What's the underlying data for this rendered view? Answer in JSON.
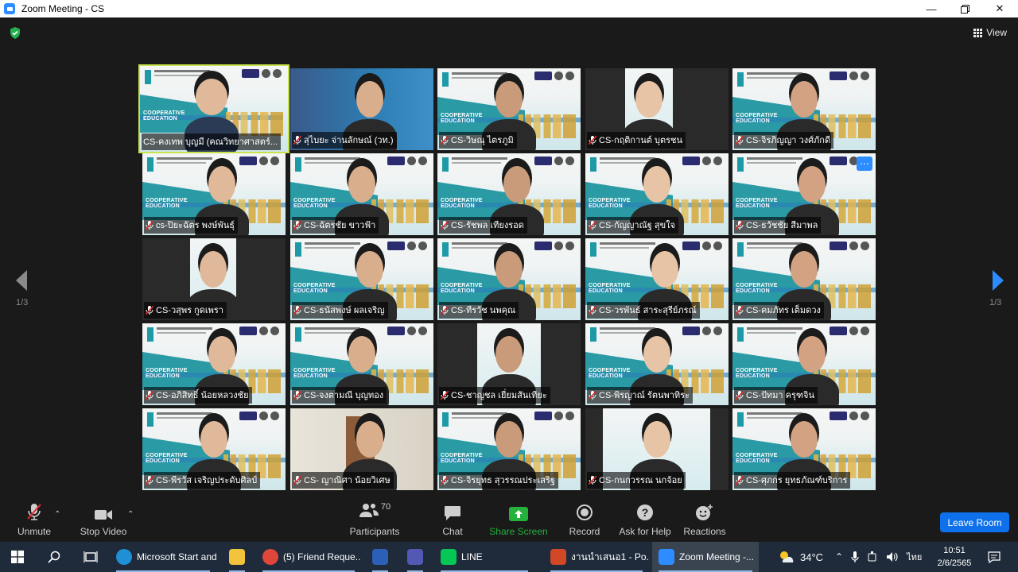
{
  "window": {
    "title": "Zoom Meeting - CS"
  },
  "meeting": {
    "view_label": "View",
    "page_left": "1/3",
    "page_right": "1/3"
  },
  "participants": [
    {
      "name": "CS-คงเทพ บุญมี (คณวิทยาศาสตร์...",
      "muted": false,
      "active": true
    },
    {
      "name": "สุไบยะ จ่านลักษณ์ (วท.)",
      "muted": true
    },
    {
      "name": "CS-วิษณุ ไตรภูมิ",
      "muted": true
    },
    {
      "name": "CS-กฤติกานต์ บุตรชน",
      "muted": true
    },
    {
      "name": "CS-จิรภิญญา วงศ์ภักดี",
      "muted": true
    },
    {
      "name": "cs-ปิยะฉัตร พงษ์พันธุ์",
      "muted": true
    },
    {
      "name": "CS-ฉัตรชัย ขาวฟ้า",
      "muted": true
    },
    {
      "name": "CS-รัชพล เทียงรอด",
      "muted": true
    },
    {
      "name": "CS-กัญญาณัฐ สุขใจ",
      "muted": true
    },
    {
      "name": "CS-ธวัชชัย สีมาพล",
      "muted": true
    },
    {
      "name": "CS-วสุพร กูดเพรา",
      "muted": true
    },
    {
      "name": "CS-ธนัสพงษ์ ผลเจริญ",
      "muted": true
    },
    {
      "name": "CS-ทีรวัช นพคุณ",
      "muted": true
    },
    {
      "name": "CS-วรพันธ์ สาระสุรีย์ภรณ์",
      "muted": true
    },
    {
      "name": "CS-คมภัทร เต็มดวง",
      "muted": true
    },
    {
      "name": "CS-อภิสิทธิ์ น้อยหลวงชัย",
      "muted": true
    },
    {
      "name": "CS-จงตามณี บุญทอง",
      "muted": true
    },
    {
      "name": "CS-ชาญชล เยี่ยมสันเทียะ",
      "muted": true
    },
    {
      "name": "CS-พิรญาณ์ รัตนพาทิระ",
      "muted": true
    },
    {
      "name": "CS-ปัทมา ครุฑจิน",
      "muted": true
    },
    {
      "name": "CS-พีรวัส เจริญประดับศิลป์",
      "muted": true
    },
    {
      "name": "CS- ญาณิศา น้อยวิเศษ",
      "muted": true
    },
    {
      "name": "CS-จิรยุทธ สุวรรณประเสริฐ",
      "muted": true
    },
    {
      "name": "CS-กนกวรรณ นกจ้อย",
      "muted": true
    },
    {
      "name": "CS-ศุภกร ยุทธภัณฑ์บริการ",
      "muted": true
    }
  ],
  "slide_text": {
    "coop": "COOPERATIVE",
    "edu": "EDUCATION"
  },
  "toolbar": {
    "unmute": "Unmute",
    "stop_video": "Stop Video",
    "participants": "Participants",
    "participants_count": "70",
    "chat": "Chat",
    "share_screen": "Share Screen",
    "record": "Record",
    "ask_for_help": "Ask for Help",
    "reactions": "Reactions",
    "leave": "Leave Room"
  },
  "taskbar": {
    "apps": [
      {
        "label": "Microsoft Start and...",
        "icon": "edge-icon"
      },
      {
        "label": "",
        "icon": "file-explorer-icon"
      },
      {
        "label": "(5) Friend Reque...",
        "icon": "chrome-icon"
      },
      {
        "label": "",
        "icon": "word-icon"
      },
      {
        "label": "",
        "icon": "teams-icon"
      },
      {
        "label": "LINE",
        "icon": "line-icon"
      },
      {
        "label": "งานนำเสนอ1 - Po...",
        "icon": "powerpoint-icon"
      },
      {
        "label": "Zoom Meeting -...",
        "icon": "zoom-icon"
      }
    ],
    "weather": "34°C",
    "language": "ไทย",
    "time": "10:51",
    "date": "2/6/2565"
  },
  "colors": {
    "active_speaker": "#c7e34a",
    "leave": "#0e71eb",
    "share": "#24b23c",
    "accent": "#2d8cff"
  }
}
